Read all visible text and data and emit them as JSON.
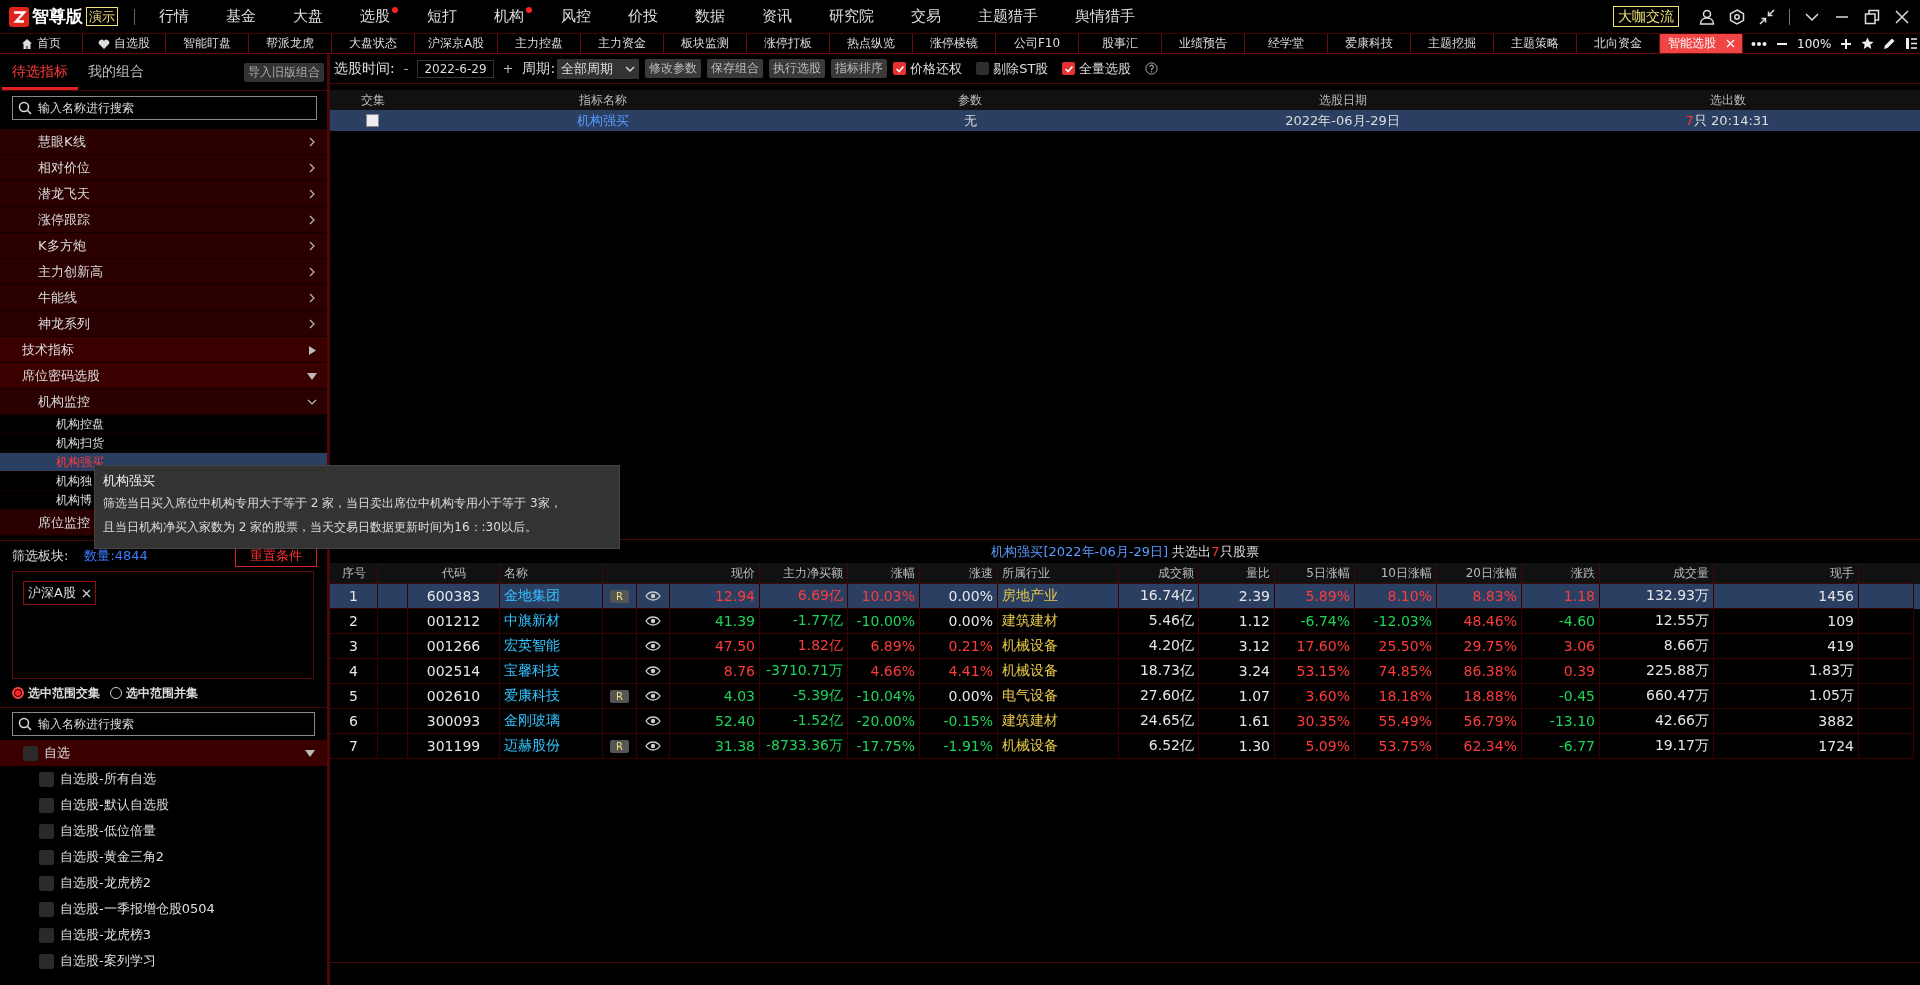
{
  "app": {
    "edition": "智尊版",
    "badge": "演示"
  },
  "menu": [
    {
      "label": "行情",
      "dot": false
    },
    {
      "label": "基金",
      "dot": false
    },
    {
      "label": "大盘",
      "dot": false
    },
    {
      "label": "选股",
      "dot": true
    },
    {
      "label": "短打",
      "dot": false
    },
    {
      "label": "机构",
      "dot": true
    },
    {
      "label": "风控",
      "dot": false
    },
    {
      "label": "价投",
      "dot": false
    },
    {
      "label": "数据",
      "dot": false
    },
    {
      "label": "资讯",
      "dot": false
    },
    {
      "label": "研究院",
      "dot": false
    },
    {
      "label": "交易",
      "dot": false
    },
    {
      "label": "主题猎手",
      "dot": false
    },
    {
      "label": "舆情猎手",
      "dot": false
    }
  ],
  "community_button": "大咖交流",
  "tabs": [
    {
      "label": "首页",
      "kind": "home",
      "selected": false
    },
    {
      "label": "自选股",
      "kind": "favorites",
      "selected": false
    },
    {
      "label": "智能盯盘",
      "kind": "page",
      "selected": false
    },
    {
      "label": "帮派龙虎",
      "kind": "page",
      "selected": false
    },
    {
      "label": "大盘状态",
      "kind": "page",
      "selected": false
    },
    {
      "label": "沪深京A股",
      "kind": "page",
      "selected": false
    },
    {
      "label": "主力控盘",
      "kind": "page",
      "selected": false
    },
    {
      "label": "主力资金",
      "kind": "page",
      "selected": false
    },
    {
      "label": "板块监测",
      "kind": "page",
      "selected": false
    },
    {
      "label": "涨停打板",
      "kind": "page",
      "selected": false
    },
    {
      "label": "热点纵览",
      "kind": "page",
      "selected": false
    },
    {
      "label": "涨停棱镜",
      "kind": "page",
      "selected": false
    },
    {
      "label": "公司F10",
      "kind": "page",
      "selected": false
    },
    {
      "label": "股事汇",
      "kind": "page",
      "selected": false
    },
    {
      "label": "业绩预告",
      "kind": "page",
      "selected": false
    },
    {
      "label": "经学堂",
      "kind": "page",
      "selected": false
    },
    {
      "label": "爱康科技",
      "kind": "page",
      "selected": false
    },
    {
      "label": "主题挖掘",
      "kind": "page",
      "selected": false
    },
    {
      "label": "主题策略",
      "kind": "page",
      "selected": false
    },
    {
      "label": "北向资金",
      "kind": "page",
      "selected": false
    },
    {
      "label": "智能选股",
      "kind": "page",
      "selected": true,
      "closable": true
    }
  ],
  "zoom_level": "100%",
  "left_panel": {
    "tabs": [
      {
        "label": "待选指标",
        "selected": true
      },
      {
        "label": "我的组合",
        "selected": false
      }
    ],
    "import_button": "导入旧版组合",
    "search_placeholder": "输入名称进行搜索",
    "indicator_tree": [
      {
        "children": [
          {
            "label": "慧眼K线",
            "expanded": false
          },
          {
            "label": "相对价位",
            "expanded": false
          },
          {
            "label": "潜龙飞天",
            "expanded": false
          },
          {
            "label": "涨停跟踪",
            "expanded": false
          },
          {
            "label": "K多方炮",
            "expanded": false
          },
          {
            "label": "主力创新高",
            "expanded": false
          },
          {
            "label": "牛能线",
            "expanded": false
          },
          {
            "label": "神龙系列",
            "expanded": false
          }
        ]
      },
      {
        "label": "技术指标",
        "expanded": false
      },
      {
        "label": "席位密码选股",
        "expanded": true,
        "children": [
          {
            "label": "机构监控",
            "expanded": true,
            "children": [
              {
                "label": "机构控盘",
                "selected": false
              },
              {
                "label": "机构扫货",
                "selected": false
              },
              {
                "label": "机构强买",
                "selected": true
              },
              {
                "label": "机构独",
                "selected": false
              },
              {
                "label": "机构博",
                "selected": false
              }
            ]
          },
          {
            "label": "席位监控"
          }
        ]
      }
    ],
    "filter": {
      "label": "筛选板块:",
      "count": "数量:4844",
      "reset_button": "重置条件",
      "tags": [
        "沪深A股"
      ],
      "modes": [
        {
          "label": "选中范围交集",
          "selected": true
        },
        {
          "label": "选中范围并集",
          "selected": false
        }
      ],
      "search_placeholder": "输入名称进行搜索",
      "tree": [
        {
          "label": "自选",
          "checked": false,
          "expanded": true,
          "children": [
            {
              "label": "自选股-所有自选",
              "checked": false
            },
            {
              "label": "自选股-默认自选股",
              "checked": false
            },
            {
              "label": "自选股-低位倍量",
              "checked": false
            },
            {
              "label": "自选股-黄金三角2",
              "checked": false
            },
            {
              "label": "自选股-龙虎榜2",
              "checked": false
            },
            {
              "label": "自选股-一季报增仓股0504",
              "checked": false
            },
            {
              "label": "自选股-龙虎榜3",
              "checked": false
            },
            {
              "label": "自选股-案列学习",
              "checked": false
            }
          ]
        }
      ]
    }
  },
  "tooltip": {
    "title": "机构强买",
    "lines": [
      "筛选当日买入席位中机构专用大于等于 2 家，当日卖出席位中机构专用小于等于 3家，",
      "且当日机构净买入家数为 2 家的股票，当天交易日数据更新时间为16：:30以后。"
    ]
  },
  "toolbar": {
    "date_label": "选股时间:",
    "minus": "-",
    "date": "2022-6-29",
    "plus": "+",
    "period_label": "周期:",
    "period": "全部周期",
    "buttons": [
      "修改参数",
      "保存组合",
      "执行选股",
      "指标排序"
    ],
    "options": [
      {
        "label": "价格还权",
        "checked": true
      },
      {
        "label": "剔除ST股",
        "checked": false
      },
      {
        "label": "全量选股",
        "checked": true
      }
    ]
  },
  "selection_table": {
    "columns": [
      "交集",
      "指标名称",
      "参数",
      "选股日期",
      "选出数"
    ],
    "rows": [
      {
        "checked": false,
        "selected": true,
        "name": "机构强买",
        "params": "无",
        "date": "2022年-06月-29日",
        "count": "7",
        "count_unit": "只",
        "time": "20:14:31"
      }
    ]
  },
  "results": {
    "title": "机构强买[2022年-06月-29日]",
    "summary_prefix": "共选出",
    "count": "7",
    "summary_suffix": "只股票",
    "columns": [
      "序号",
      "代码",
      "名称",
      "现价",
      "主力净买额",
      "涨幅",
      "涨速",
      "所属行业",
      "成交额",
      "量比",
      "5日涨幅",
      "10日涨幅",
      "20日涨幅",
      "涨跌",
      "成交量",
      "现手"
    ],
    "rows": [
      {
        "selected": true,
        "badge": "R",
        "cells": [
          {
            "text": "1",
            "kind": "plain"
          },
          {
            "text": "600383",
            "kind": "plain"
          },
          {
            "text": "金地集团",
            "kind": "name"
          },
          {
            "text": "12.94",
            "kind": "up"
          },
          {
            "text": "6.69亿",
            "kind": "up"
          },
          {
            "text": "10.03%",
            "kind": "up"
          },
          {
            "text": "0.00%",
            "kind": "plain"
          },
          {
            "text": "房地产业",
            "kind": "sector"
          },
          {
            "text": "16.74亿",
            "kind": "plain"
          },
          {
            "text": "2.39",
            "kind": "plain"
          },
          {
            "text": "5.89%",
            "kind": "up"
          },
          {
            "text": "8.10%",
            "kind": "up"
          },
          {
            "text": "8.83%",
            "kind": "up"
          },
          {
            "text": "1.18",
            "kind": "up"
          },
          {
            "text": "132.93万",
            "kind": "plain"
          },
          {
            "text": "1456",
            "kind": "plain"
          }
        ]
      },
      {
        "selected": false,
        "cells": [
          {
            "text": "2",
            "kind": "plain"
          },
          {
            "text": "001212",
            "kind": "plain"
          },
          {
            "text": "中旗新材",
            "kind": "name"
          },
          {
            "text": "41.39",
            "kind": "down"
          },
          {
            "text": "-1.77亿",
            "kind": "down"
          },
          {
            "text": "-10.00%",
            "kind": "down"
          },
          {
            "text": "0.00%",
            "kind": "plain"
          },
          {
            "text": "建筑建材",
            "kind": "sector"
          },
          {
            "text": "5.46亿",
            "kind": "plain"
          },
          {
            "text": "1.12",
            "kind": "plain"
          },
          {
            "text": "-6.74%",
            "kind": "down"
          },
          {
            "text": "-12.03%",
            "kind": "down"
          },
          {
            "text": "48.46%",
            "kind": "up"
          },
          {
            "text": "-4.60",
            "kind": "down"
          },
          {
            "text": "12.55万",
            "kind": "plain"
          },
          {
            "text": "109",
            "kind": "plain"
          }
        ]
      },
      {
        "selected": false,
        "cells": [
          {
            "text": "3",
            "kind": "plain"
          },
          {
            "text": "001266",
            "kind": "plain"
          },
          {
            "text": "宏英智能",
            "kind": "name"
          },
          {
            "text": "47.50",
            "kind": "up"
          },
          {
            "text": "1.82亿",
            "kind": "up"
          },
          {
            "text": "6.89%",
            "kind": "up"
          },
          {
            "text": "0.21%",
            "kind": "up"
          },
          {
            "text": "机械设备",
            "kind": "sector"
          },
          {
            "text": "4.20亿",
            "kind": "plain"
          },
          {
            "text": "3.12",
            "kind": "plain"
          },
          {
            "text": "17.60%",
            "kind": "up"
          },
          {
            "text": "25.50%",
            "kind": "up"
          },
          {
            "text": "29.75%",
            "kind": "up"
          },
          {
            "text": "3.06",
            "kind": "up"
          },
          {
            "text": "8.66万",
            "kind": "plain"
          },
          {
            "text": "419",
            "kind": "plain"
          }
        ]
      },
      {
        "selected": false,
        "cells": [
          {
            "text": "4",
            "kind": "plain"
          },
          {
            "text": "002514",
            "kind": "plain"
          },
          {
            "text": "宝馨科技",
            "kind": "name"
          },
          {
            "text": "8.76",
            "kind": "up"
          },
          {
            "text": "-3710.71万",
            "kind": "down"
          },
          {
            "text": "4.66%",
            "kind": "up"
          },
          {
            "text": "4.41%",
            "kind": "up"
          },
          {
            "text": "机械设备",
            "kind": "sector"
          },
          {
            "text": "18.73亿",
            "kind": "plain"
          },
          {
            "text": "3.24",
            "kind": "plain"
          },
          {
            "text": "53.15%",
            "kind": "up"
          },
          {
            "text": "74.85%",
            "kind": "up"
          },
          {
            "text": "86.38%",
            "kind": "up"
          },
          {
            "text": "0.39",
            "kind": "up"
          },
          {
            "text": "225.88万",
            "kind": "plain"
          },
          {
            "text": "1.83万",
            "kind": "plain"
          }
        ]
      },
      {
        "selected": false,
        "badge": "R",
        "cells": [
          {
            "text": "5",
            "kind": "plain"
          },
          {
            "text": "002610",
            "kind": "plain"
          },
          {
            "text": "爱康科技",
            "kind": "name"
          },
          {
            "text": "4.03",
            "kind": "down"
          },
          {
            "text": "-5.39亿",
            "kind": "down"
          },
          {
            "text": "-10.04%",
            "kind": "down"
          },
          {
            "text": "0.00%",
            "kind": "plain"
          },
          {
            "text": "电气设备",
            "kind": "sector"
          },
          {
            "text": "27.60亿",
            "kind": "plain"
          },
          {
            "text": "1.07",
            "kind": "plain"
          },
          {
            "text": "3.60%",
            "kind": "up"
          },
          {
            "text": "18.18%",
            "kind": "up"
          },
          {
            "text": "18.88%",
            "kind": "up"
          },
          {
            "text": "-0.45",
            "kind": "down"
          },
          {
            "text": "660.47万",
            "kind": "plain"
          },
          {
            "text": "1.05万",
            "kind": "plain"
          }
        ]
      },
      {
        "selected": false,
        "cells": [
          {
            "text": "6",
            "kind": "plain"
          },
          {
            "text": "300093",
            "kind": "plain"
          },
          {
            "text": "金刚玻璃",
            "kind": "name"
          },
          {
            "text": "52.40",
            "kind": "down"
          },
          {
            "text": "-1.52亿",
            "kind": "down"
          },
          {
            "text": "-20.00%",
            "kind": "down"
          },
          {
            "text": "-0.15%",
            "kind": "down"
          },
          {
            "text": "建筑建材",
            "kind": "sector"
          },
          {
            "text": "24.65亿",
            "kind": "plain"
          },
          {
            "text": "1.61",
            "kind": "plain"
          },
          {
            "text": "30.35%",
            "kind": "up"
          },
          {
            "text": "55.49%",
            "kind": "up"
          },
          {
            "text": "56.79%",
            "kind": "up"
          },
          {
            "text": "-13.10",
            "kind": "down"
          },
          {
            "text": "42.66万",
            "kind": "plain"
          },
          {
            "text": "3882",
            "kind": "plain"
          }
        ]
      },
      {
        "selected": false,
        "badge": "R",
        "cells": [
          {
            "text": "7",
            "kind": "plain"
          },
          {
            "text": "301199",
            "kind": "plain"
          },
          {
            "text": "迈赫股份",
            "kind": "name"
          },
          {
            "text": "31.38",
            "kind": "down"
          },
          {
            "text": "-8733.36万",
            "kind": "down"
          },
          {
            "text": "-17.75%",
            "kind": "down"
          },
          {
            "text": "-1.91%",
            "kind": "down"
          },
          {
            "text": "机械设备",
            "kind": "sector"
          },
          {
            "text": "6.52亿",
            "kind": "plain"
          },
          {
            "text": "1.30",
            "kind": "plain"
          },
          {
            "text": "5.09%",
            "kind": "up"
          },
          {
            "text": "53.75%",
            "kind": "up"
          },
          {
            "text": "62.34%",
            "kind": "up"
          },
          {
            "text": "-6.77",
            "kind": "down"
          },
          {
            "text": "19.17万",
            "kind": "plain"
          },
          {
            "text": "1724",
            "kind": "plain"
          }
        ]
      }
    ]
  }
}
